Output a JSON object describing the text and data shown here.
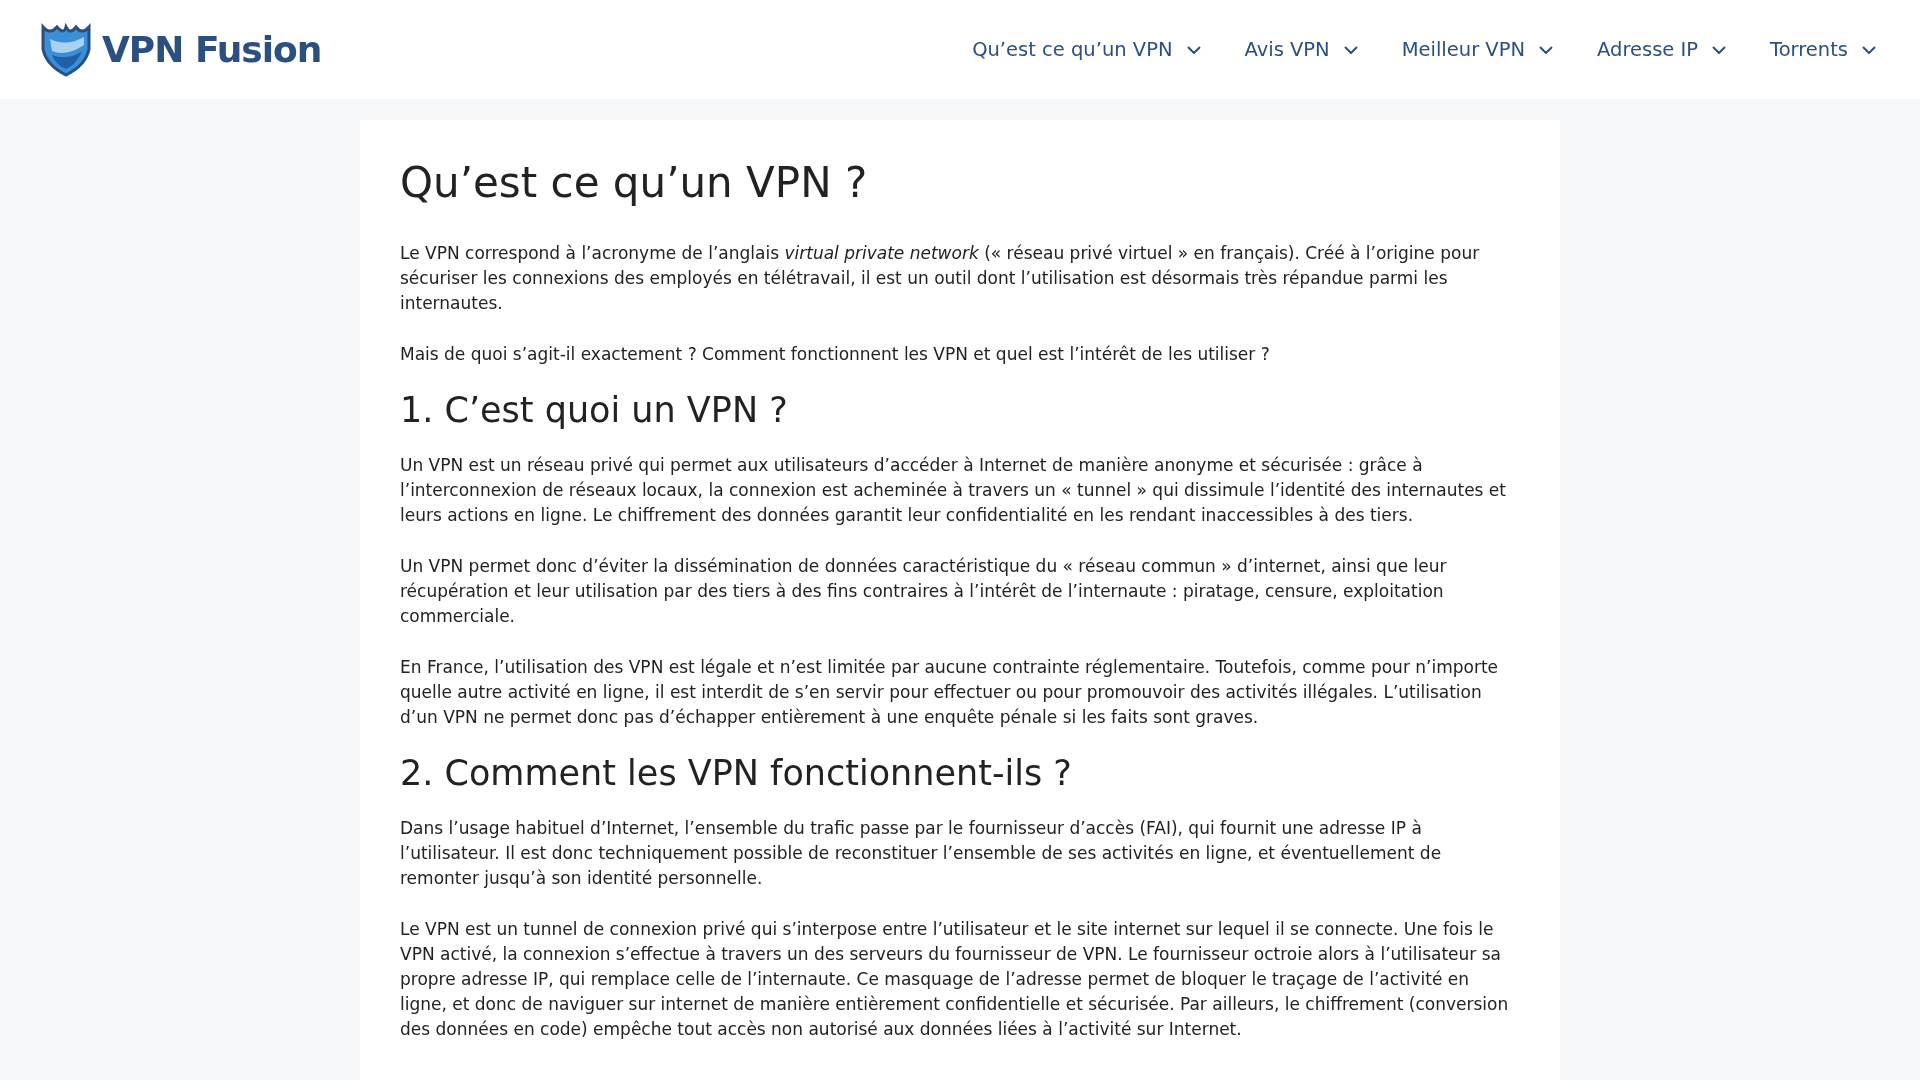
{
  "header": {
    "logo": "VPN Fusion",
    "nav": [
      {
        "label": "Qu’est ce qu’un VPN"
      },
      {
        "label": "Avis VPN"
      },
      {
        "label": "Meilleur VPN"
      },
      {
        "label": "Adresse IP"
      },
      {
        "label": "Torrents"
      }
    ]
  },
  "article": {
    "title": "Qu’est ce qu’un VPN ?",
    "blocks": [
      {
        "kind": "paragraph",
        "text": "Le VPN correspond à l’acronyme de l’anglais *virtual private network* (« réseau privé virtuel » en français). Créé à l’origine pour sécuriser les connexions des employés en télétravail, il est un outil dont l’utilisation est désormais très répandue parmi les internautes."
      },
      {
        "kind": "paragraph",
        "text": "Mais de quoi s’agit-il exactement ? Comment fonctionnent les VPN et quel est l’intérêt de les utiliser ?"
      },
      {
        "kind": "heading",
        "text": "1. C’est quoi un VPN ?"
      },
      {
        "kind": "paragraph",
        "text": "Un VPN est un réseau privé qui permet aux utilisateurs d’accéder à Internet de manière anonyme et sécurisée : grâce à l’interconnexion de réseaux locaux, la connexion est acheminée à travers un « tunnel » qui dissimule l’identité des internautes et leurs actions en ligne. Le chiffrement des données garantit leur confidentialité en les rendant inaccessibles à des tiers."
      },
      {
        "kind": "paragraph",
        "text": "Un VPN permet donc d’éviter la dissémination de données caractéristique du « réseau commun » d’internet, ainsi que leur récupération et leur utilisation par des tiers à des fins contraires à l’intérêt de l’internaute : piratage, censure, exploitation commerciale."
      },
      {
        "kind": "paragraph",
        "text": "En France, l’utilisation des VPN est légale et n’est limitée par aucune contrainte réglementaire. Toutefois, comme pour n’importe quelle autre activité en ligne, il est interdit de s’en servir pour effectuer ou pour promouvoir des activités illégales. L’utilisation d’un VPN ne permet donc pas d’échapper entièrement à une enquête pénale si les faits sont graves."
      },
      {
        "kind": "heading",
        "text": "2. Comment les VPN fonctionnent-ils ?"
      },
      {
        "kind": "paragraph",
        "text": "Dans l’usage habituel d’Internet, l’ensemble du trafic passe par le fournisseur d’accès (FAI), qui fournit une adresse IP à l’utilisateur. Il est donc techniquement possible de reconstituer l’ensemble de ses activités en ligne, et éventuellement de remonter jusqu’à son identité personnelle."
      },
      {
        "kind": "paragraph",
        "text": "Le VPN est un tunnel de connexion privé qui s’interpose entre l’utilisateur et le site internet sur lequel il se connecte. Une fois le VPN activé, la connexion s’effectue à travers un des serveurs du fournisseur de VPN. Le fournisseur octroie alors à l’utilisateur sa propre adresse IP, qui remplace celle de l’internaute. Ce masquage de l’adresse permet de bloquer le traçage de l’activité en ligne, et donc de naviguer sur internet de manière entièrement confidentielle et sécurisée. Par ailleurs, le chiffrement (conversion des données en code) empêche tout accès non autorisé aux données liées à l’activité sur Internet."
      }
    ]
  }
}
